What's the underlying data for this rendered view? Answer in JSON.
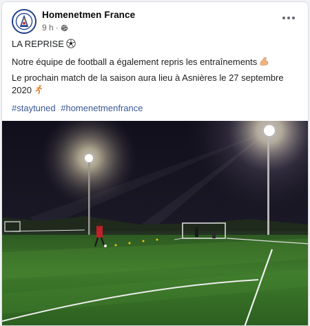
{
  "post": {
    "page_name": "Homenetmen France",
    "time": "9 h",
    "separator": "·",
    "lines": {
      "title": "LA REPRISE",
      "sentence1": "Notre équipe de football a également repris les entraînements",
      "sentence2": "Le prochain match de la saison aura lieu à Asnières le 27 septembre 2020"
    },
    "hashtags": [
      "#staytuned",
      "#homenetmenfrance"
    ],
    "icons": {
      "avatar": "homenetmen-logo",
      "audience": "globe-icon",
      "more": "more-options-icon",
      "title_emoji": "soccer-ball-emoji",
      "sentence1_emoji": "flexed-biceps-emoji",
      "sentence2_emoji": "running-person-emoji"
    }
  },
  "colors": {
    "hashtag": "#385898",
    "meta": "#65676b",
    "turf": "#2e6b1f"
  }
}
